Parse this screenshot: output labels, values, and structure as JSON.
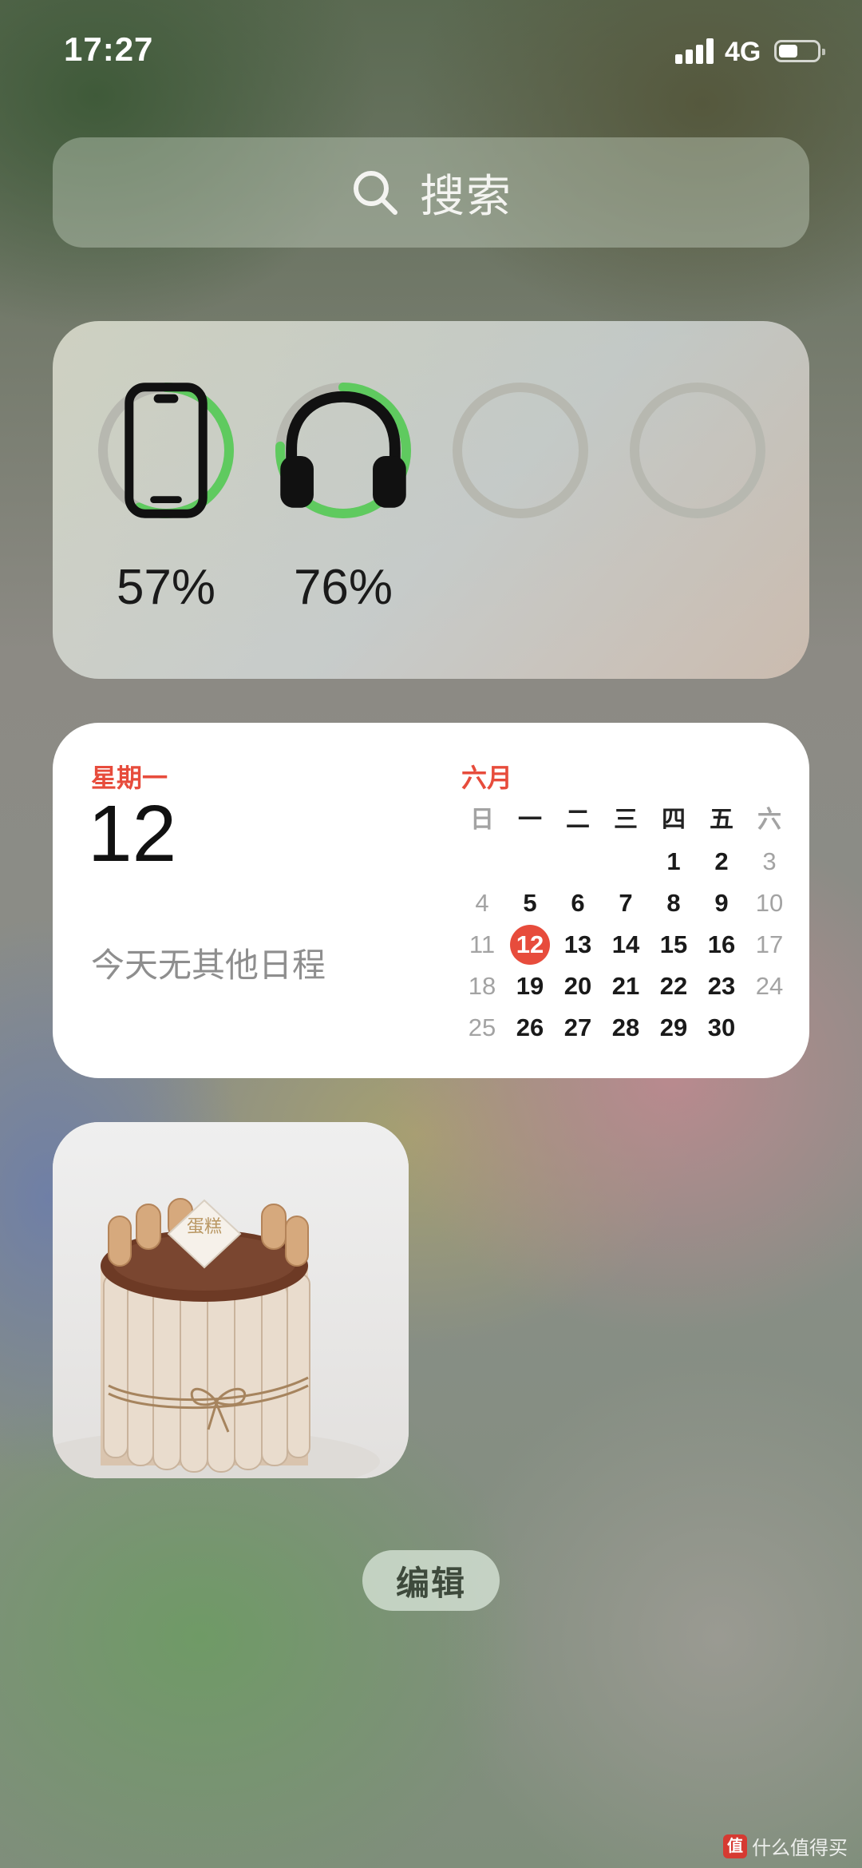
{
  "status_bar": {
    "time": "17:27",
    "network": "4G",
    "battery_level": 0.5,
    "signal_bars": 4
  },
  "search": {
    "placeholder": "搜索",
    "icon": "search-icon"
  },
  "batteries": {
    "accent_color": "#5fca5f",
    "track_color": "#b7b8b0",
    "devices": [
      {
        "icon": "iphone-icon",
        "percent_label": "57%",
        "level": 0.57
      },
      {
        "icon": "headphones-icon",
        "percent_label": "76%",
        "level": 0.76
      },
      {
        "icon": "",
        "percent_label": "",
        "level": 0
      },
      {
        "icon": "",
        "percent_label": "",
        "level": 0
      }
    ]
  },
  "calendar": {
    "weekday": "星期一",
    "day": "12",
    "no_events": "今天无其他日程",
    "month": "六月",
    "accent_color": "#e74c3c",
    "headers": [
      "日",
      "一",
      "二",
      "三",
      "四",
      "五",
      "六"
    ],
    "weeks": [
      [
        "",
        "",
        "",
        "",
        "1",
        "2",
        "3"
      ],
      [
        "4",
        "5",
        "6",
        "7",
        "8",
        "9",
        "10"
      ],
      [
        "11",
        "12",
        "13",
        "14",
        "15",
        "16",
        "17"
      ],
      [
        "18",
        "19",
        "20",
        "21",
        "22",
        "23",
        "24"
      ],
      [
        "25",
        "26",
        "27",
        "28",
        "29",
        "30",
        ""
      ]
    ],
    "today": "12"
  },
  "photo": {
    "subject": "cake-photo",
    "topper_text": "蛋糕"
  },
  "edit_button": {
    "label": "编辑"
  },
  "watermark": {
    "badge": "值",
    "text": "什么值得买"
  }
}
